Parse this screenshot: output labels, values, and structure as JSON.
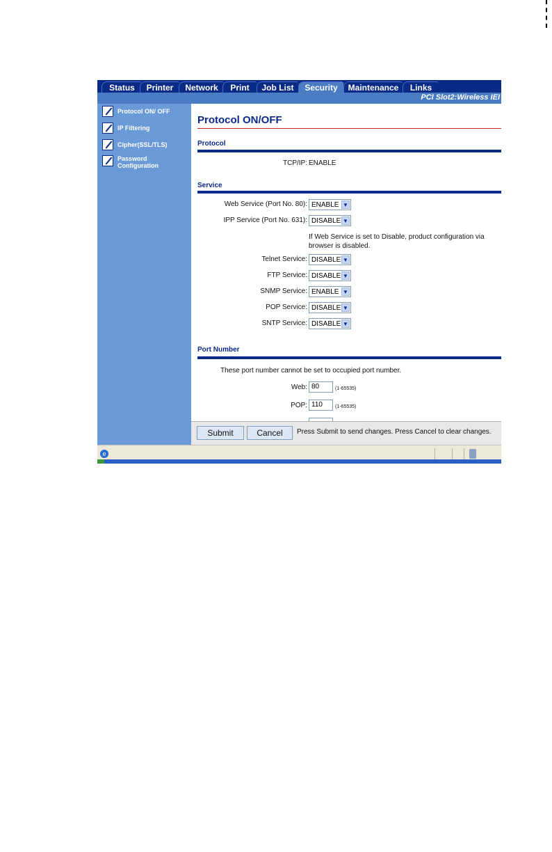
{
  "tabs": [
    {
      "label": "Status",
      "active": false
    },
    {
      "label": "Printer",
      "active": false
    },
    {
      "label": "Network",
      "active": false
    },
    {
      "label": "Print",
      "active": false
    },
    {
      "label": "Job List",
      "active": false
    },
    {
      "label": "Security",
      "active": true
    },
    {
      "label": "Maintenance",
      "active": false
    },
    {
      "label": "Links",
      "active": false
    }
  ],
  "device_label": "PCI Slot2:Wireless IEI",
  "sidebar": {
    "items": [
      {
        "label": "Protocol ON/ OFF"
      },
      {
        "label": "IP Filtering"
      },
      {
        "label": "Cipher(SSL/TLS)"
      },
      {
        "label": "Password Configuration"
      }
    ]
  },
  "page": {
    "title": "Protocol ON/OFF",
    "protocol_section": "Protocol",
    "tcpip_label": "TCP/IP:",
    "tcpip_value": "ENABLE",
    "service_section": "Service",
    "services": [
      {
        "label": "Web Service (Port No. 80):",
        "value": "ENABLE"
      },
      {
        "label": "IPP Service (Port No. 631):",
        "value": "DISABLE"
      },
      {
        "label": "Telnet Service:",
        "value": "DISABLE"
      },
      {
        "label": "FTP Service:",
        "value": "DISABLE"
      },
      {
        "label": "SNMP Service:",
        "value": "ENABLE"
      },
      {
        "label": "POP Service:",
        "value": "DISABLE"
      },
      {
        "label": "SNTP Service:",
        "value": "DISABLE"
      }
    ],
    "web_service_note": "If Web Service is set to Disable, product configuration via browser is disabled.",
    "port_section": "Port Number",
    "port_note": "These port number cannot be set to occupied port number.",
    "ports": [
      {
        "label": "Web:",
        "value": "80",
        "range": "(1-65535)"
      },
      {
        "label": "POP:",
        "value": "110",
        "range": "(1-65535)"
      }
    ]
  },
  "actions": {
    "submit_label": "Submit",
    "cancel_label": "Cancel",
    "note": "Press Submit to send changes. Press Cancel to clear changes."
  },
  "colors": {
    "nav_dark": "#0a2a88",
    "nav_light": "#4a7cc4",
    "title_rule": "#cc2222"
  }
}
